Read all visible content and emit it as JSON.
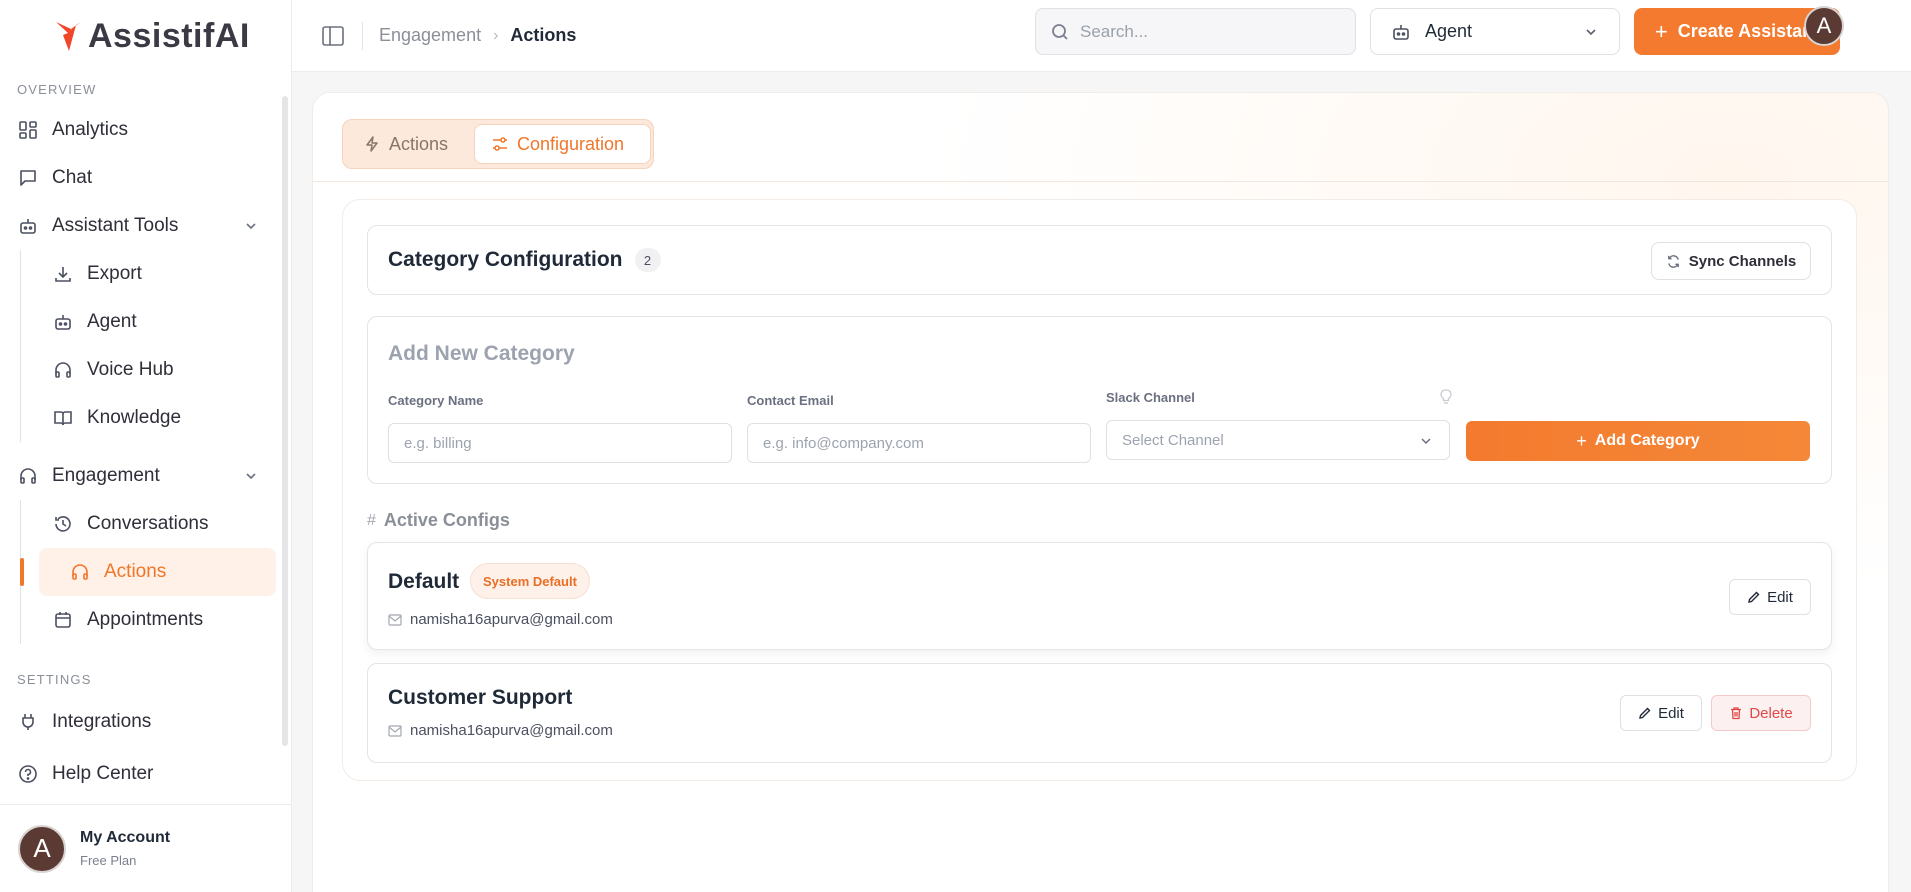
{
  "brand": {
    "name": "AssistifAI",
    "accent": "#f37a2e"
  },
  "sidebar": {
    "sections": [
      {
        "label": "OVERVIEW"
      },
      {
        "label": "SETTINGS"
      }
    ],
    "items": {
      "analytics": {
        "label": "Analytics",
        "icon": "grid-icon"
      },
      "chat": {
        "label": "Chat",
        "icon": "chat-bubble-icon"
      },
      "assistant_tools": {
        "label": "Assistant Tools",
        "icon": "bot-icon"
      },
      "export": {
        "label": "Export",
        "icon": "download-icon"
      },
      "agent": {
        "label": "Agent",
        "icon": "bot-icon"
      },
      "voice_hub": {
        "label": "Voice Hub",
        "icon": "headphones-icon"
      },
      "knowledge": {
        "label": "Knowledge",
        "icon": "book-icon"
      },
      "engagement": {
        "label": "Engagement",
        "icon": "headphones-icon"
      },
      "conversations": {
        "label": "Conversations",
        "icon": "history-icon"
      },
      "actions": {
        "label": "Actions",
        "icon": "headphones-icon"
      },
      "appointments": {
        "label": "Appointments",
        "icon": "calendar-icon"
      },
      "integrations": {
        "label": "Integrations",
        "icon": "plug-icon"
      },
      "help_center": {
        "label": "Help Center",
        "icon": "help-circle-icon"
      }
    },
    "account": {
      "initial": "A",
      "name": "My Account",
      "plan": "Free Plan"
    }
  },
  "topbar": {
    "breadcrumb": [
      "Engagement",
      "Actions"
    ],
    "search_placeholder": "Search...",
    "agent_select": "Agent",
    "create_button": "Create Assistant",
    "avatar_initial": "A"
  },
  "tabs": [
    {
      "label": "Actions",
      "icon": "lightning-icon",
      "selected": false
    },
    {
      "label": "Configuration",
      "icon": "sliders-icon",
      "selected": true
    }
  ],
  "category_config": {
    "title": "Category Configuration",
    "count": "2",
    "sync_button": "Sync Channels"
  },
  "add_category": {
    "title": "Add New Category",
    "name_label": "Category Name",
    "name_placeholder": "e.g. billing",
    "email_label": "Contact Email",
    "email_placeholder": "e.g. info@company.com",
    "slack_label": "Slack Channel",
    "slack_placeholder": "Select Channel",
    "add_button": "Add Category"
  },
  "active_configs": {
    "label": "Active Configs",
    "items": [
      {
        "name": "Default",
        "badge": "System Default",
        "email": "namisha16apurva@gmail.com",
        "edit": "Edit"
      },
      {
        "name": "Customer Support",
        "email": "namisha16apurva@gmail.com",
        "edit": "Edit",
        "delete": "Delete"
      }
    ]
  }
}
